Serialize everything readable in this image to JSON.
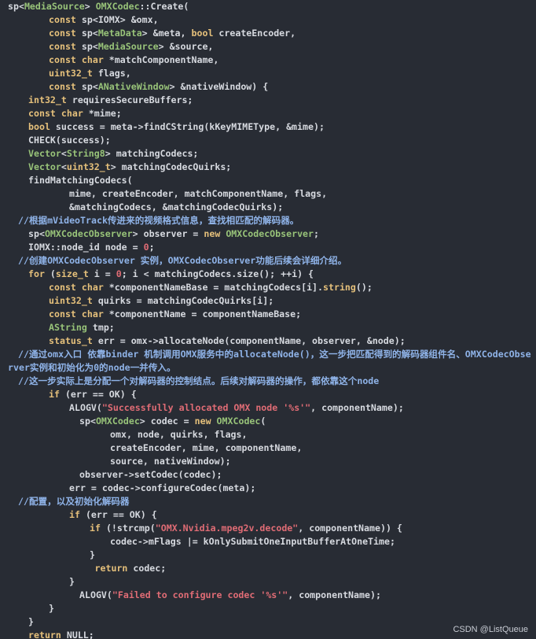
{
  "watermark": "CSDN @ListQueue",
  "colors": {
    "background": "#282c34",
    "plain": "#d7dae0",
    "keyword": "#e5c07b",
    "class_name": "#98c379",
    "string": "#e06c75",
    "comment": "#8fb3e8"
  },
  "lines": [
    {
      "indent": 0,
      "tokens": [
        [
          "plain",
          "sp<"
        ],
        [
          "class",
          "MediaSource"
        ],
        [
          "plain",
          "> "
        ],
        [
          "class",
          "OMXCodec"
        ],
        [
          "plain",
          "::Create("
        ]
      ]
    },
    {
      "indent": 8,
      "tokens": [
        [
          "keyword",
          "const"
        ],
        [
          "plain",
          " sp<IOMX> &omx,"
        ]
      ]
    },
    {
      "indent": 8,
      "tokens": [
        [
          "keyword",
          "const"
        ],
        [
          "plain",
          " sp<"
        ],
        [
          "class",
          "MetaData"
        ],
        [
          "plain",
          "> &meta, "
        ],
        [
          "keyword",
          "bool"
        ],
        [
          "plain",
          " createEncoder,"
        ]
      ]
    },
    {
      "indent": 8,
      "tokens": [
        [
          "keyword",
          "const"
        ],
        [
          "plain",
          " sp<"
        ],
        [
          "class",
          "MediaSource"
        ],
        [
          "plain",
          "> &source,"
        ]
      ]
    },
    {
      "indent": 8,
      "tokens": [
        [
          "keyword",
          "const"
        ],
        [
          "plain",
          " "
        ],
        [
          "keyword",
          "char"
        ],
        [
          "plain",
          " *matchComponentName,"
        ]
      ]
    },
    {
      "indent": 8,
      "tokens": [
        [
          "type",
          "uint32_t"
        ],
        [
          "plain",
          " flags,"
        ]
      ]
    },
    {
      "indent": 8,
      "tokens": [
        [
          "keyword",
          "const"
        ],
        [
          "plain",
          " sp<"
        ],
        [
          "class",
          "ANativeWindow"
        ],
        [
          "plain",
          "> &nativeWindow) {"
        ]
      ]
    },
    {
      "indent": 4,
      "tokens": [
        [
          "type",
          "int32_t"
        ],
        [
          "plain",
          " requiresSecureBuffers;"
        ]
      ]
    },
    {
      "indent": 4,
      "tokens": [
        [
          "keyword",
          "const"
        ],
        [
          "plain",
          " "
        ],
        [
          "keyword",
          "char"
        ],
        [
          "plain",
          " *mime;"
        ]
      ]
    },
    {
      "indent": 4,
      "tokens": [
        [
          "keyword",
          "bool"
        ],
        [
          "plain",
          " success = meta->findCString(kKeyMIMEType, &mime);"
        ]
      ]
    },
    {
      "indent": 4,
      "tokens": [
        [
          "plain",
          "CHECK(success);"
        ]
      ]
    },
    {
      "indent": 4,
      "tokens": [
        [
          "class",
          "Vector"
        ],
        [
          "plain",
          "<"
        ],
        [
          "class",
          "String8"
        ],
        [
          "plain",
          "> matchingCodecs;"
        ]
      ]
    },
    {
      "indent": 4,
      "tokens": [
        [
          "class",
          "Vector"
        ],
        [
          "plain",
          "<"
        ],
        [
          "type",
          "uint32_t"
        ],
        [
          "plain",
          "> matchingCodecQuirks;"
        ]
      ]
    },
    {
      "indent": 4,
      "tokens": [
        [
          "plain",
          "findMatchingCodecs("
        ]
      ]
    },
    {
      "indent": 12,
      "tokens": [
        [
          "plain",
          "mime, createEncoder, matchComponentName, flags,"
        ]
      ]
    },
    {
      "indent": 12,
      "tokens": [
        [
          "plain",
          "&matchingCodecs, &matchingCodecQuirks);"
        ]
      ]
    },
    {
      "indent": 2,
      "tokens": [
        [
          "comment",
          "//根据mVideoTrack传进来的视频格式信息，查找相匹配的解码器。"
        ]
      ]
    },
    {
      "indent": 4,
      "tokens": [
        [
          "plain",
          "sp<"
        ],
        [
          "class",
          "OMXCodecObserver"
        ],
        [
          "plain",
          "> observer = "
        ],
        [
          "keyword",
          "new"
        ],
        [
          "plain",
          " "
        ],
        [
          "class",
          "OMXCodecObserver"
        ],
        [
          "plain",
          ";"
        ]
      ]
    },
    {
      "indent": 4,
      "tokens": [
        [
          "plain",
          "IOMX::node_id node = "
        ],
        [
          "number",
          "0"
        ],
        [
          "plain",
          ";"
        ]
      ]
    },
    {
      "indent": 2,
      "tokens": [
        [
          "comment",
          "//创建OMXCodecObserver 实例，OMXCodecObserver功能后续会详细介绍。"
        ]
      ]
    },
    {
      "indent": 4,
      "tokens": [
        [
          "keyword",
          "for"
        ],
        [
          "plain",
          " ("
        ],
        [
          "type",
          "size_t"
        ],
        [
          "plain",
          " i = "
        ],
        [
          "number",
          "0"
        ],
        [
          "plain",
          "; i < matchingCodecs.size(); ++i) {"
        ]
      ]
    },
    {
      "indent": 8,
      "tokens": [
        [
          "keyword",
          "const"
        ],
        [
          "plain",
          " "
        ],
        [
          "keyword",
          "char"
        ],
        [
          "plain",
          " *componentNameBase = matchingCodecs[i]."
        ],
        [
          "keyword",
          "string"
        ],
        [
          "plain",
          "();"
        ]
      ]
    },
    {
      "indent": 8,
      "tokens": [
        [
          "type",
          "uint32_t"
        ],
        [
          "plain",
          " quirks = matchingCodecQuirks[i];"
        ]
      ]
    },
    {
      "indent": 8,
      "tokens": [
        [
          "keyword",
          "const"
        ],
        [
          "plain",
          " "
        ],
        [
          "keyword",
          "char"
        ],
        [
          "plain",
          " *componentName = componentNameBase;"
        ]
      ]
    },
    {
      "indent": 8,
      "tokens": [
        [
          "class",
          "AString"
        ],
        [
          "plain",
          " tmp;"
        ]
      ]
    },
    {
      "indent": 8,
      "tokens": [
        [
          "type",
          "status_t"
        ],
        [
          "plain",
          " err = omx->allocateNode(componentName, observer, &node);"
        ]
      ]
    },
    {
      "indent": 2,
      "wrap": true,
      "tokens": [
        [
          "comment",
          "//通过omx入口 依靠binder 机制调用OMX服务中的allocateNode()，这一步把匹配得到的解码器组件名、OMXCodecObserver实例和初始化为0的node一并传入。"
        ]
      ]
    },
    {
      "indent": 2,
      "tokens": [
        [
          "comment",
          "//这一步实际上是分配一个对解码器的控制结点。后续对解码器的操作，都依靠这个node"
        ]
      ]
    },
    {
      "indent": 8,
      "tokens": [
        [
          "keyword",
          "if"
        ],
        [
          "plain",
          " (err == OK) {"
        ]
      ]
    },
    {
      "indent": 12,
      "tokens": [
        [
          "plain",
          "ALOGV("
        ],
        [
          "string",
          "\"Successfully allocated OMX node '%s'\""
        ],
        [
          "plain",
          ", componentName);"
        ]
      ]
    },
    {
      "indent": 14,
      "tokens": [
        [
          "plain",
          "sp<"
        ],
        [
          "class",
          "OMXCodec"
        ],
        [
          "plain",
          "> codec = "
        ],
        [
          "keyword",
          "new"
        ],
        [
          "plain",
          " "
        ],
        [
          "class",
          "OMXCodec"
        ],
        [
          "plain",
          "("
        ]
      ]
    },
    {
      "indent": 20,
      "tokens": [
        [
          "plain",
          "omx, node, quirks, flags,"
        ]
      ]
    },
    {
      "indent": 20,
      "tokens": [
        [
          "plain",
          "createEncoder, mime, componentName,"
        ]
      ]
    },
    {
      "indent": 20,
      "tokens": [
        [
          "plain",
          "source, nativeWindow);"
        ]
      ]
    },
    {
      "indent": 14,
      "tokens": [
        [
          "plain",
          "observer->setCodec(codec);"
        ]
      ]
    },
    {
      "indent": 12,
      "tokens": [
        [
          "plain",
          "err = codec->configureCodec(meta);"
        ]
      ]
    },
    {
      "indent": 2,
      "tokens": [
        [
          "comment",
          "//配置，以及初始化解码器"
        ]
      ]
    },
    {
      "indent": 12,
      "tokens": [
        [
          "keyword",
          "if"
        ],
        [
          "plain",
          " (err == OK) {"
        ]
      ]
    },
    {
      "indent": 16,
      "tokens": [
        [
          "keyword",
          "if"
        ],
        [
          "plain",
          " (!strcmp("
        ],
        [
          "string",
          "\"OMX.Nvidia.mpeg2v.decode\""
        ],
        [
          "plain",
          ", componentName)) {"
        ]
      ]
    },
    {
      "indent": 20,
      "tokens": [
        [
          "plain",
          "codec->mFlags |= kOnlySubmitOneInputBufferAtOneTime;"
        ]
      ]
    },
    {
      "indent": 16,
      "tokens": [
        [
          "plain",
          "}"
        ]
      ]
    },
    {
      "indent": 17,
      "tokens": [
        [
          "keyword",
          "return"
        ],
        [
          "plain",
          " codec;"
        ]
      ]
    },
    {
      "indent": 12,
      "tokens": [
        [
          "plain",
          "}"
        ]
      ]
    },
    {
      "indent": 14,
      "tokens": [
        [
          "plain",
          "ALOGV("
        ],
        [
          "string",
          "\"Failed to configure codec '%s'\""
        ],
        [
          "plain",
          ", componentName);"
        ]
      ]
    },
    {
      "indent": 8,
      "tokens": [
        [
          "plain",
          "}"
        ]
      ]
    },
    {
      "indent": 4,
      "tokens": [
        [
          "plain",
          "}"
        ]
      ]
    },
    {
      "indent": 4,
      "tokens": [
        [
          "keyword",
          "return"
        ],
        [
          "plain",
          " NULL;"
        ]
      ]
    }
  ]
}
